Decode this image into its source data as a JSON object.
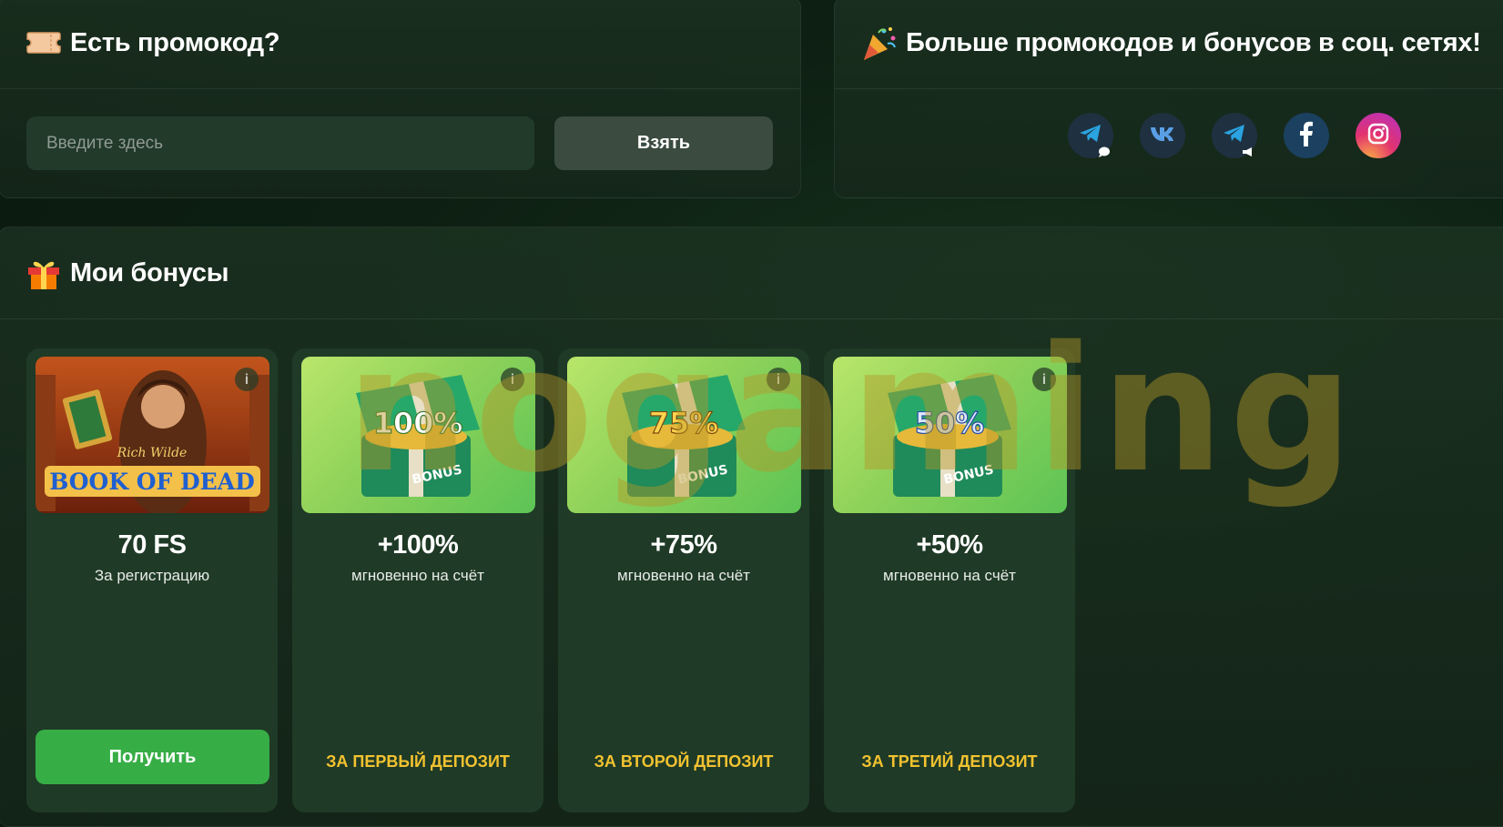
{
  "promo": {
    "title": "Есть промокод?",
    "icon": "ticket-icon",
    "input_placeholder": "Введите здесь",
    "input_value": "",
    "button_label": "Взять"
  },
  "social": {
    "title": "Больше промокодов и бонусов в соц. сетях!",
    "icon": "party-popper-icon",
    "links": [
      {
        "icon": "telegram-chat-icon"
      },
      {
        "icon": "vk-icon"
      },
      {
        "icon": "telegram-channel-icon"
      },
      {
        "icon": "facebook-icon"
      },
      {
        "icon": "instagram-icon"
      }
    ]
  },
  "bonuses": {
    "title": "Мои бонусы",
    "icon": "gift-icon",
    "cards": [
      {
        "image": "Book of Dead slot art",
        "image_text": "BOOK OF DEAD",
        "value": "70 FS",
        "description": "За регистрацию",
        "button_label": "Получить",
        "footer": ""
      },
      {
        "image": "bonus chest",
        "image_text": "100%",
        "value": "+100%",
        "description": "мгновенно на счёт",
        "button_label": "",
        "footer": "ЗА ПЕРВЫЙ ДЕПОЗИТ"
      },
      {
        "image": "bonus chest",
        "image_text": "75%",
        "value": "+75%",
        "description": "мгновенно на счёт",
        "button_label": "",
        "footer": "ЗА ВТОРОЙ ДЕПОЗИТ"
      },
      {
        "image": "bonus chest",
        "image_text": "50%",
        "value": "+50%",
        "description": "мгновенно на счёт",
        "button_label": "",
        "footer": "ЗА ТРЕТИЙ ДЕПОЗИТ"
      }
    ],
    "info_label": "i",
    "chest_label": "BONUS"
  },
  "watermark": "nogaming",
  "colors": {
    "accent_green": "#37ad46",
    "footer_gold": "#f2c230",
    "card_bg": "#1f3a26"
  }
}
